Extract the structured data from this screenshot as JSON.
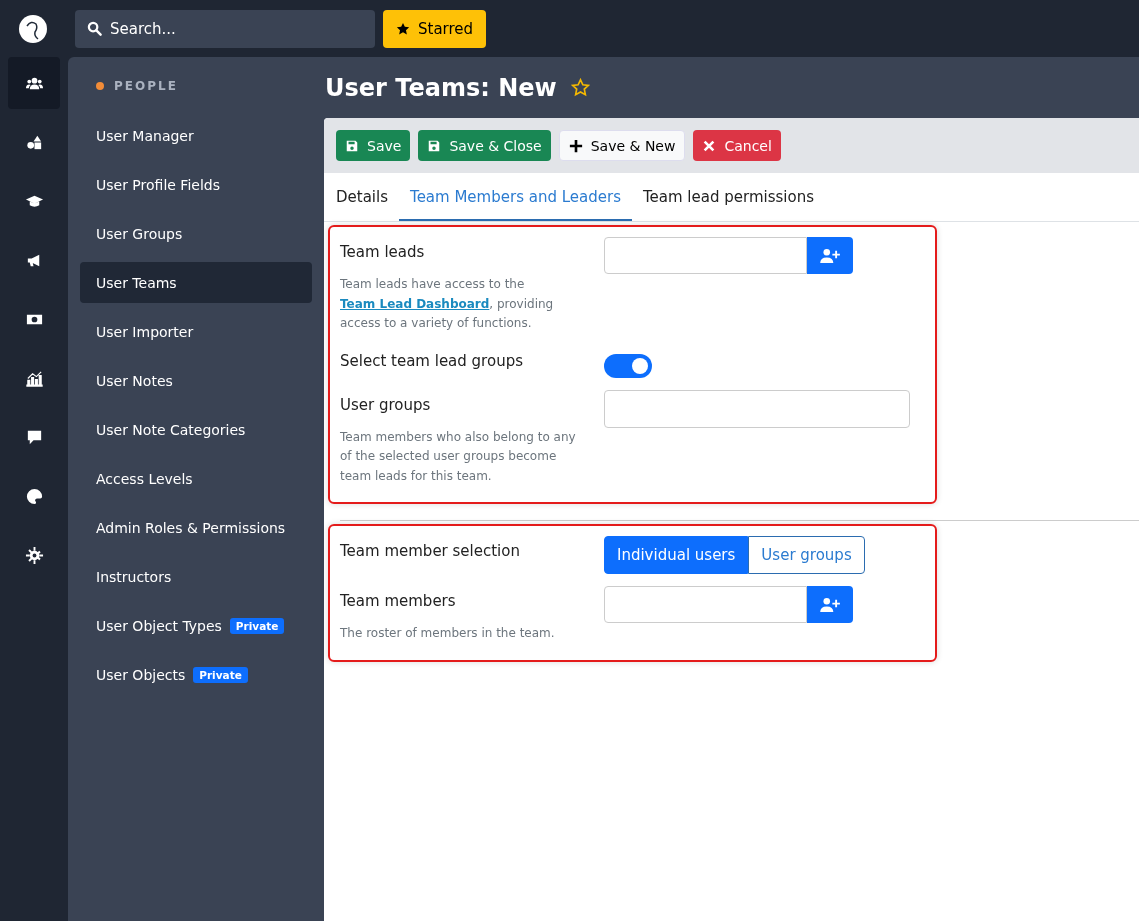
{
  "topbar": {
    "search": {
      "placeholder": "Search..."
    },
    "starred_button": "Starred"
  },
  "rail": [
    {
      "kind": "users",
      "selected": true
    },
    {
      "kind": "shapes",
      "selected": false
    },
    {
      "kind": "graduation",
      "selected": false
    },
    {
      "kind": "megaphone",
      "selected": false
    },
    {
      "kind": "money",
      "selected": false
    },
    {
      "kind": "chart",
      "selected": false
    },
    {
      "kind": "comment",
      "selected": false
    },
    {
      "kind": "palette",
      "selected": false
    },
    {
      "kind": "gear",
      "selected": false
    }
  ],
  "sidebar": {
    "heading": "PEOPLE",
    "items": [
      {
        "label": "User Manager",
        "selected": false
      },
      {
        "label": "User Profile Fields",
        "selected": false
      },
      {
        "label": "User Groups",
        "selected": false
      },
      {
        "label": "User Teams",
        "selected": true
      },
      {
        "label": "User Importer",
        "selected": false
      },
      {
        "label": "User Notes",
        "selected": false
      },
      {
        "label": "User Note Categories",
        "selected": false
      },
      {
        "label": "Access Levels",
        "selected": false
      },
      {
        "label": "Admin Roles & Permissions",
        "selected": false
      },
      {
        "label": "Instructors",
        "selected": false
      },
      {
        "label": "User Object Types",
        "selected": false,
        "badge": "Private"
      },
      {
        "label": "User Objects",
        "selected": false,
        "badge": "Private"
      }
    ]
  },
  "page_title": "User Teams: New",
  "toolbar": [
    {
      "label": "Save",
      "kind": "save"
    },
    {
      "label": "Save & Close",
      "kind": "save"
    },
    {
      "label": "Save & New",
      "kind": "new"
    },
    {
      "label": "Cancel",
      "kind": "cancel"
    }
  ],
  "tabs": [
    {
      "label": "Details",
      "selected": false
    },
    {
      "label": "Team Members and Leaders",
      "selected": true
    },
    {
      "label": "Team lead permissions",
      "selected": false
    }
  ],
  "sections": [
    {
      "rows": [
        {
          "kind": "picker",
          "label": "Team leads",
          "description": {
            "before": "Team leads have access to the ",
            "link": "Team Lead Dashboard",
            "after": ", providing access to a variety of functions."
          }
        },
        {
          "kind": "toggle",
          "label": "Select team lead groups",
          "on": true
        },
        {
          "kind": "text",
          "label": "User groups",
          "description": {
            "before": "Team members who also belong to any of the selected user groups become team leads for this team."
          }
        }
      ]
    },
    {
      "rows": [
        {
          "kind": "segmented",
          "label": "Team member selection",
          "options": [
            {
              "label": "Individual users",
              "selected": true
            },
            {
              "label": "User groups",
              "selected": false
            }
          ]
        },
        {
          "kind": "picker",
          "label": "Team members",
          "description": {
            "before": "The roster of members in the team."
          }
        }
      ]
    }
  ]
}
